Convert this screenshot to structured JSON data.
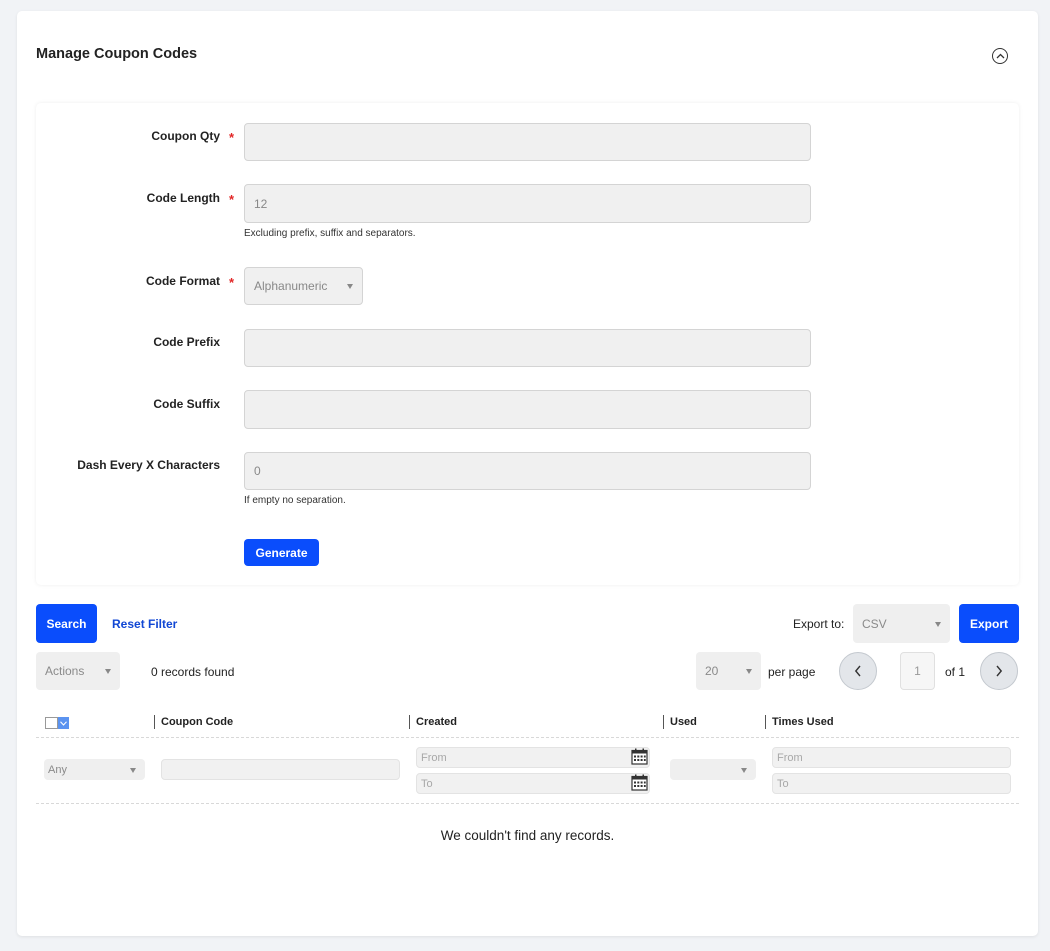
{
  "header": {
    "title": "Manage Coupon Codes"
  },
  "form": {
    "coupon_qty": {
      "label": "Coupon Qty",
      "required": "*",
      "value": ""
    },
    "code_length": {
      "label": "Code Length",
      "required": "*",
      "value": "12",
      "note": "Excluding prefix, suffix and separators."
    },
    "code_format": {
      "label": "Code Format",
      "required": "*",
      "value": "Alphanumeric"
    },
    "code_prefix": {
      "label": "Code Prefix",
      "value": ""
    },
    "code_suffix": {
      "label": "Code Suffix",
      "value": ""
    },
    "dash_every": {
      "label": "Dash Every X Characters",
      "value": "0",
      "note": "If empty no separation."
    },
    "generate_label": "Generate"
  },
  "toolbar": {
    "search_label": "Search",
    "reset_label": "Reset Filter",
    "export_to_label": "Export to:",
    "export_format": "CSV",
    "export_label": "Export"
  },
  "grid_controls": {
    "actions": "Actions",
    "records_found": "0 records found",
    "per_page_value": "20",
    "per_page_label": "per page",
    "page_current": "1",
    "page_total_label": "of 1"
  },
  "table": {
    "columns": [
      "Coupon Code",
      "Created",
      "Used",
      "Times Used"
    ],
    "filters": {
      "select_any": "Any",
      "created_from": "From",
      "created_to": "To",
      "times_from": "From",
      "times_to": "To"
    },
    "empty_message": "We couldn't find any records."
  },
  "colors": {
    "primary": "#0a4dfc",
    "link": "#1147d4",
    "required": "#e22626"
  }
}
